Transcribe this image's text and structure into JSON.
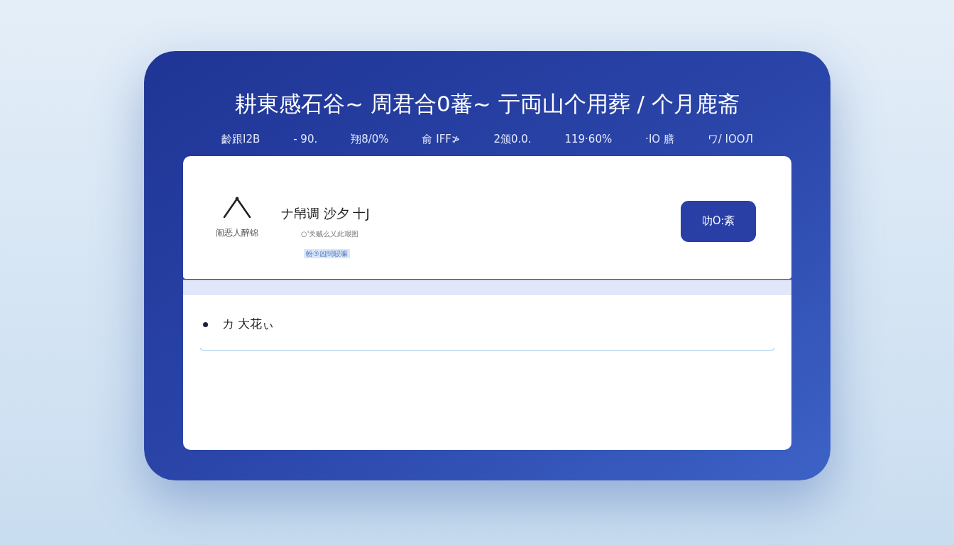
{
  "hero": {
    "title": "耕東感石谷~ 周君合0蕃~ 亍両山个用葬 / 个月鹿斋",
    "stats": [
      "齡跟I2B",
      "- 90.",
      "翔8/0%",
      "俞 IFF≯",
      "2颁0.0.",
      "119·60%",
      "·IO 膳",
      "ワ/ IOOЛ"
    ]
  },
  "summary_card": {
    "icon_caption": "闹恶人醉锦",
    "title": "ナ帠调 沙夕 十J",
    "subtitle": "○'关贼么乂此艰图",
    "tag": "帉③凶闊駸嘛",
    "button": "叻O:紊"
  },
  "list_card": {
    "items": [
      "カ 大花ぃ"
    ]
  }
}
